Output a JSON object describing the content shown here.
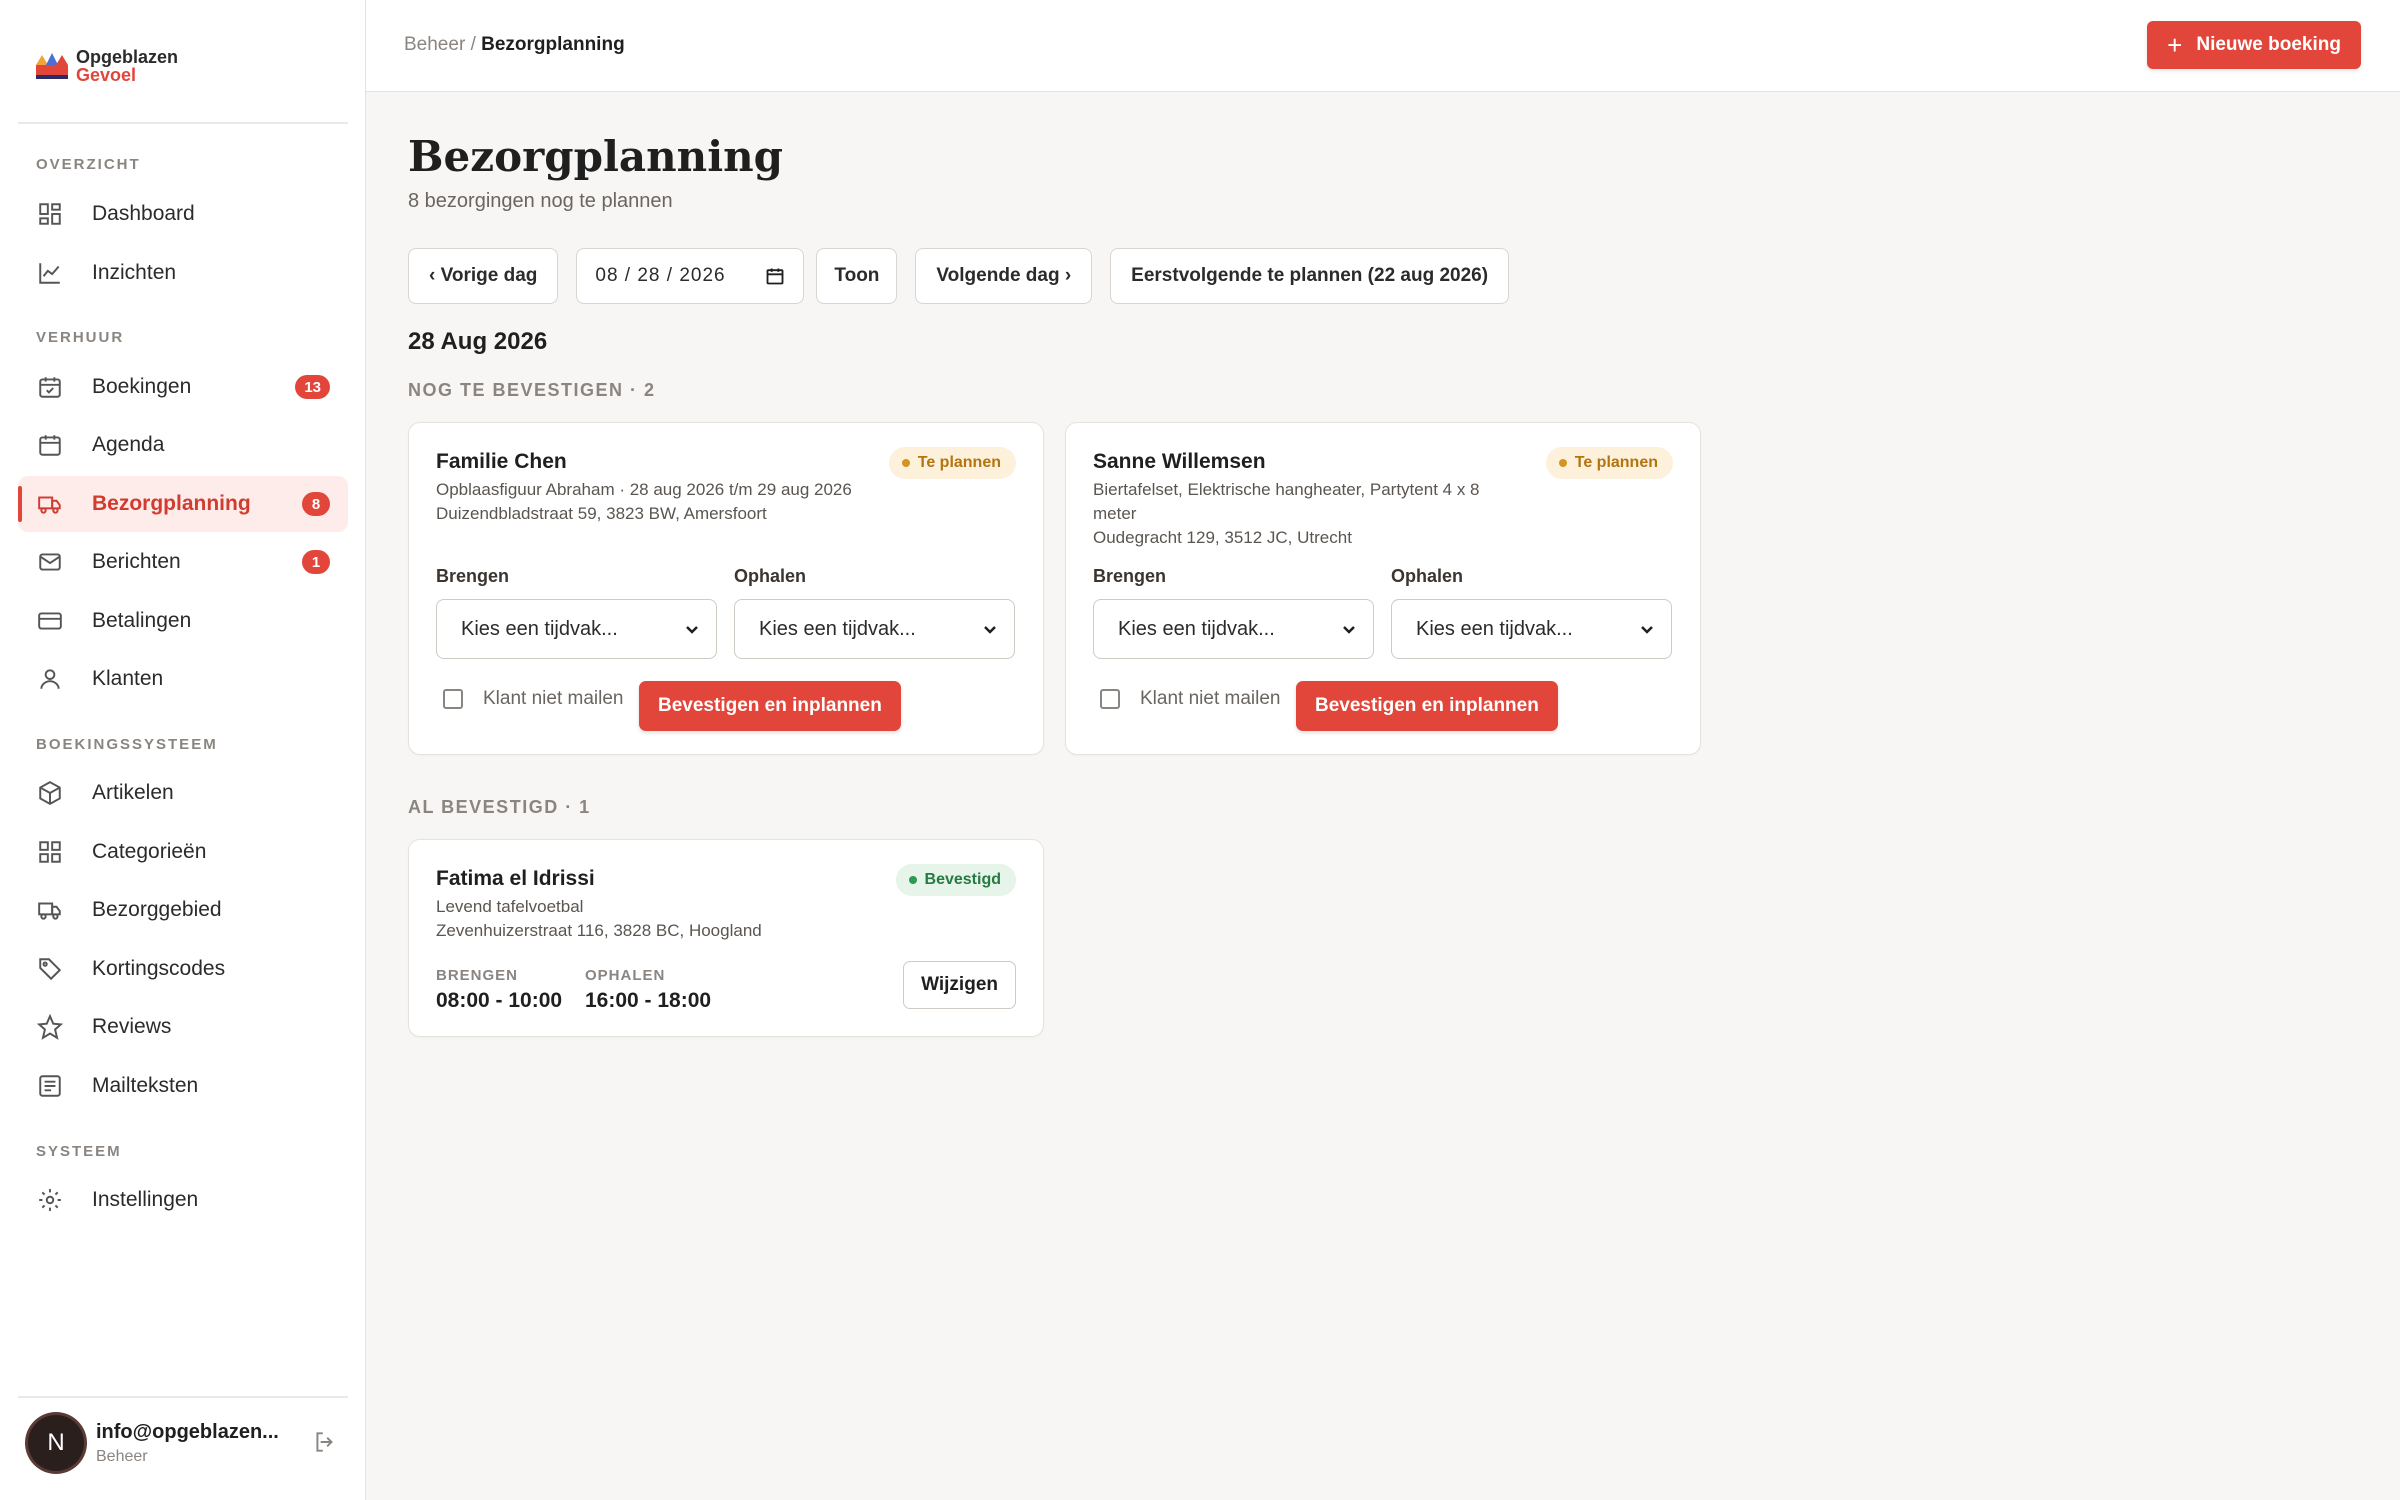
{
  "brand": {
    "line1": "Opgeblazen",
    "line2": "Gevoel",
    "accent": "#e2463a"
  },
  "sidebar": {
    "sections": [
      {
        "label": "OVERZICHT"
      },
      {
        "label": "VERHUUR"
      },
      {
        "label": "BOEKINGSSYSTEEM"
      },
      {
        "label": "SYSTEEM"
      }
    ],
    "items": [
      {
        "label": "Dashboard",
        "icon": "dashboard-icon"
      },
      {
        "label": "Inzichten",
        "icon": "chart-icon"
      },
      {
        "label": "Boekingen",
        "icon": "calendar-check-icon",
        "badge": "13"
      },
      {
        "label": "Agenda",
        "icon": "calendar-icon"
      },
      {
        "label": "Bezorgplanning",
        "icon": "truck-icon",
        "badge": "8",
        "active": true
      },
      {
        "label": "Berichten",
        "icon": "mail-icon",
        "badge": "1"
      },
      {
        "label": "Betalingen",
        "icon": "credit-card-icon"
      },
      {
        "label": "Klanten",
        "icon": "user-icon"
      },
      {
        "label": "Artikelen",
        "icon": "box-icon"
      },
      {
        "label": "Categorieën",
        "icon": "grid-icon"
      },
      {
        "label": "Bezorggebied",
        "icon": "truck-icon"
      },
      {
        "label": "Kortingscodes",
        "icon": "tag-icon"
      },
      {
        "label": "Reviews",
        "icon": "star-icon"
      },
      {
        "label": "Mailteksten",
        "icon": "document-icon"
      },
      {
        "label": "Instellingen",
        "icon": "gear-icon"
      }
    ],
    "user": {
      "initial": "N",
      "email": "info@opgeblazen...",
      "role": "Beheer"
    }
  },
  "topbar": {
    "breadcrumb_parent": "Beheer",
    "breadcrumb_separator": "/",
    "breadcrumb_current": "Bezorgplanning",
    "new_button": "Nieuwe boeking"
  },
  "page": {
    "title": "Bezorgplanning",
    "subtitle": "8 bezorgingen nog te plannen",
    "prev_day": "‹ Vorige dag",
    "date_value": "08 / 28 / 2026",
    "show_button": "Toon",
    "next_day": "Volgende dag ›",
    "first_to_plan": "Eerstvolgende te plannen (22 aug 2026)",
    "date_heading": "28 Aug 2026",
    "group_pending": "NOG TE BEVESTIGEN · 2",
    "group_confirmed": "AL BEVESTIGD · 1"
  },
  "pending": [
    {
      "name": "Familie Chen",
      "desc": "Opblaasfiguur Abraham · 28 aug 2026 t/m 29 aug 2026",
      "address": "Duizendbladstraat 59, 3823 BW, Amersfoort",
      "status": "Te plannen",
      "bring_label": "Brengen",
      "pickup_label": "Ophalen",
      "bring_value": "Kies een tijdvak...",
      "pickup_value": "Kies een tijdvak...",
      "no_mail": "Klant niet mailen",
      "confirm": "Bevestigen en inplannen"
    },
    {
      "name": "Sanne Willemsen",
      "desc": "Biertafelset, Elektrische hangheater, Partytent 4 x 8 meter",
      "address": "Oudegracht 129, 3512 JC, Utrecht",
      "status": "Te plannen",
      "bring_label": "Brengen",
      "pickup_label": "Ophalen",
      "bring_value": "Kies een tijdvak...",
      "pickup_value": "Kies een tijdvak...",
      "no_mail": "Klant niet mailen",
      "confirm": "Bevestigen en inplannen"
    }
  ],
  "confirmed": [
    {
      "name": "Fatima el Idrissi",
      "desc": "Levend tafelvoetbal",
      "address": "Zevenhuizerstraat 116, 3828 BC, Hoogland",
      "status": "Bevestigd",
      "bring_label": "BRENGEN",
      "bring_value": "08:00 - 10:00",
      "pickup_label": "OPHALEN",
      "pickup_value": "16:00 - 18:00",
      "edit": "Wijzigen"
    }
  ]
}
